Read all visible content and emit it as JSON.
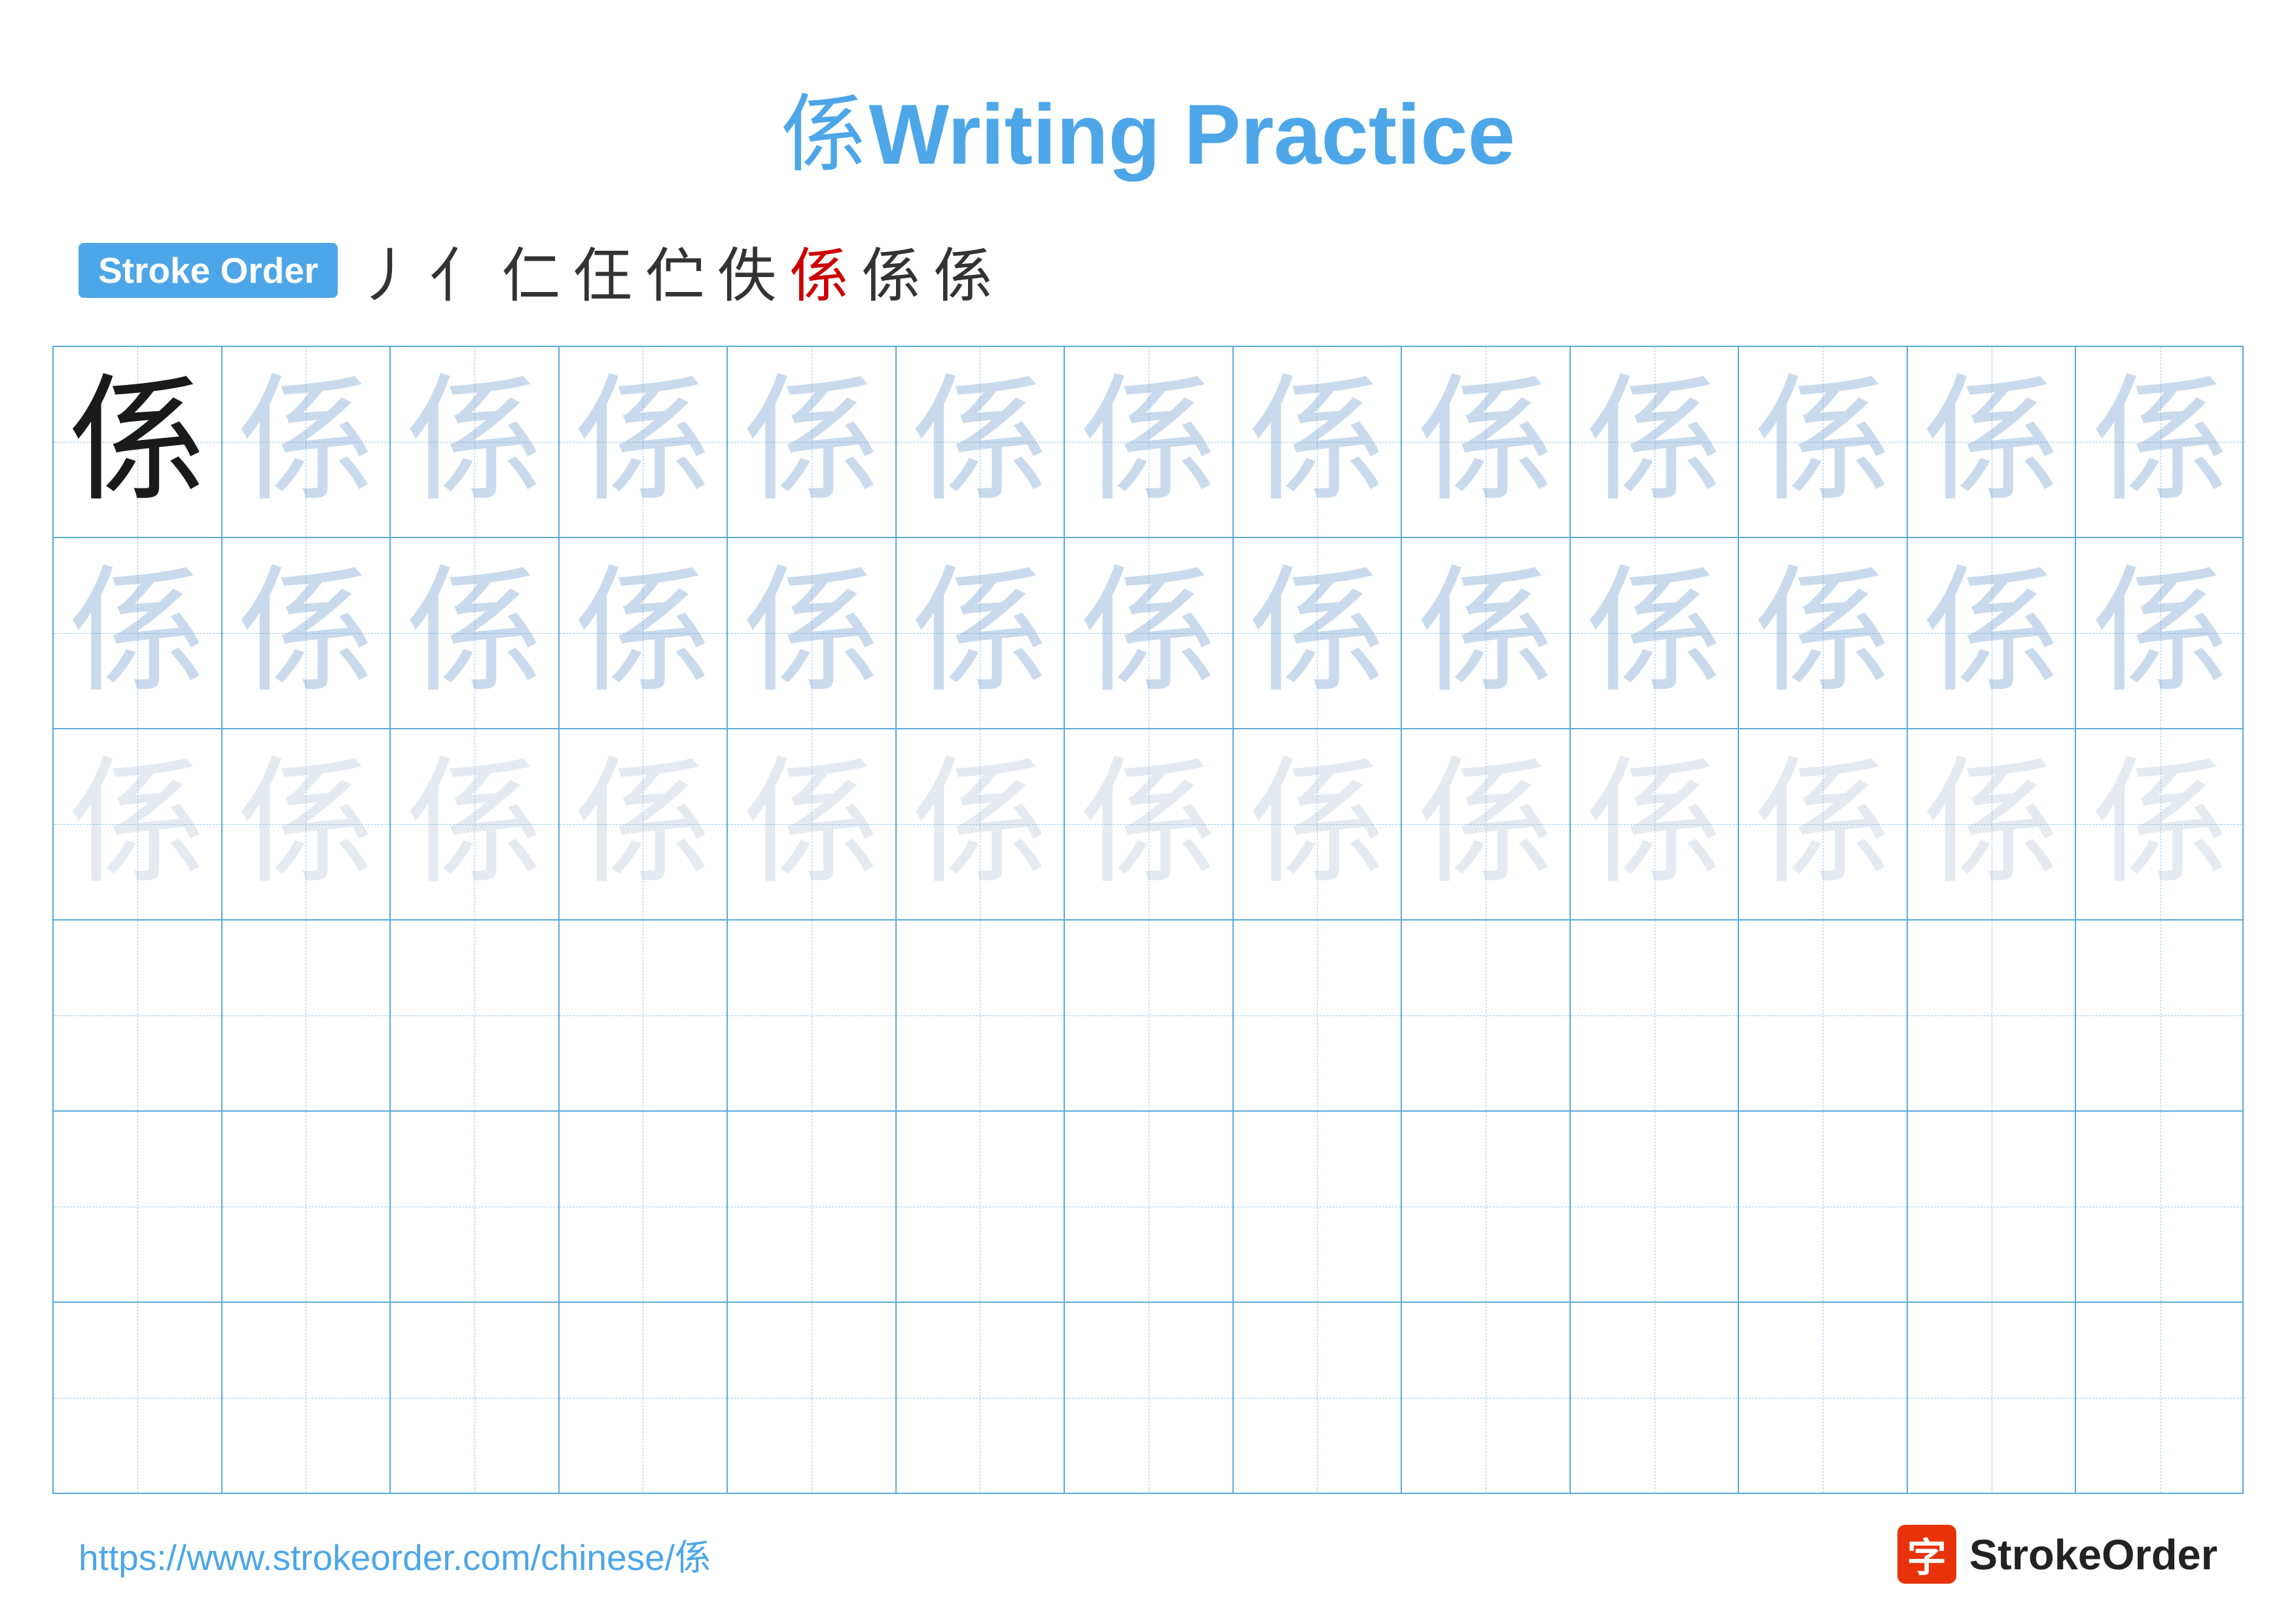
{
  "page": {
    "title": {
      "chinese": "係",
      "text": " Writing Practice"
    },
    "stroke_order": {
      "badge_label": "Stroke Order",
      "strokes": [
        "丿",
        "亻",
        "仁",
        "仼",
        "伫",
        "佚",
        "係",
        "係",
        "係"
      ]
    },
    "grid": {
      "rows": 6,
      "cols": 13,
      "char": "係",
      "row_configs": [
        {
          "type": "dark_then_light1",
          "dark_count": 1
        },
        {
          "type": "all_light2"
        },
        {
          "type": "all_light2"
        },
        {
          "type": "empty"
        },
        {
          "type": "empty"
        },
        {
          "type": "empty"
        }
      ]
    },
    "footer": {
      "url": "https://www.strokeorder.com/chinese/係",
      "logo_char": "字",
      "logo_text": "StrokeOrder"
    }
  }
}
